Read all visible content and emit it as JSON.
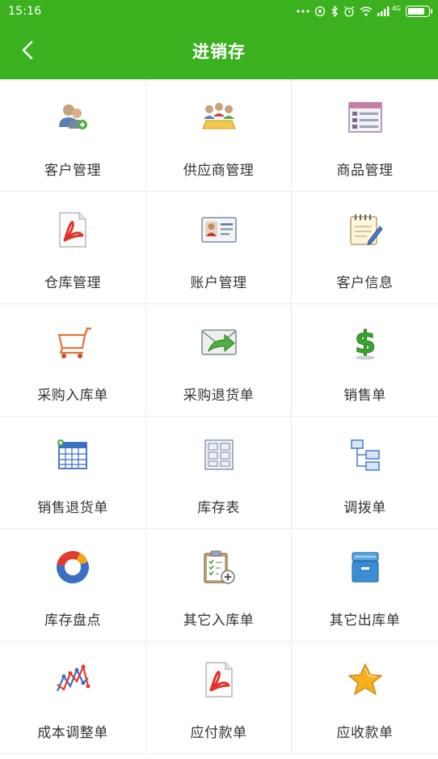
{
  "status_bar": {
    "time": "15:16",
    "signal_text": "4G",
    "battery_level": 0.85
  },
  "header": {
    "title": "进销存",
    "back_icon": "chevron-left-icon",
    "background_color": "#3cb11f"
  },
  "menu": [
    {
      "label": "客户管理",
      "icon": "customers-icon"
    },
    {
      "label": "供应商管理",
      "icon": "supplier-meeting-icon"
    },
    {
      "label": "商品管理",
      "icon": "product-list-icon"
    },
    {
      "label": "仓库管理",
      "icon": "pdf-document-icon"
    },
    {
      "label": "账户管理",
      "icon": "id-card-icon"
    },
    {
      "label": "客户信息",
      "icon": "notepad-icon"
    },
    {
      "label": "采购入库单",
      "icon": "shopping-cart-icon"
    },
    {
      "label": "采购退货单",
      "icon": "return-mail-icon"
    },
    {
      "label": "销售单",
      "icon": "dollar-icon"
    },
    {
      "label": "销售退货单",
      "icon": "table-grid-icon"
    },
    {
      "label": "库存表",
      "icon": "layout-sheet-icon"
    },
    {
      "label": "调拨单",
      "icon": "hierarchy-icon"
    },
    {
      "label": "库存盘点",
      "icon": "donut-chart-icon"
    },
    {
      "label": "其它入库单",
      "icon": "clipboard-add-icon"
    },
    {
      "label": "其它出库单",
      "icon": "archive-box-icon"
    },
    {
      "label": "成本调整单",
      "icon": "line-graph-icon"
    },
    {
      "label": "应付款单",
      "icon": "pdf-document-icon"
    },
    {
      "label": "应收款单",
      "icon": "star-icon"
    }
  ]
}
